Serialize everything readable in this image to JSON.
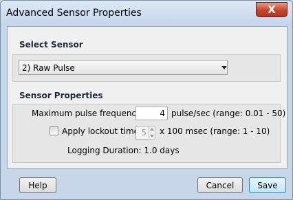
{
  "window": {
    "title": "Advanced Sensor Properties",
    "close_label": "X"
  },
  "select_sensor": {
    "header": "Select Sensor",
    "selected_value": "2) Raw Pulse"
  },
  "sensor_properties": {
    "header": "Sensor Properties",
    "max_pulse_label": "Maximum pulse frequency:",
    "max_pulse_value": "4",
    "max_pulse_unit": "pulse/sec (range: 0.01 - 50)",
    "lockout_label": "Apply lockout time:",
    "lockout_checked": false,
    "lockout_value": "5",
    "lockout_unit": "x 100 msec (range: 1 - 10)",
    "logging_duration": "Logging Duration: 1.0 days"
  },
  "footer": {
    "help_label": "Help",
    "cancel_label": "Cancel",
    "save_label": "Save"
  }
}
